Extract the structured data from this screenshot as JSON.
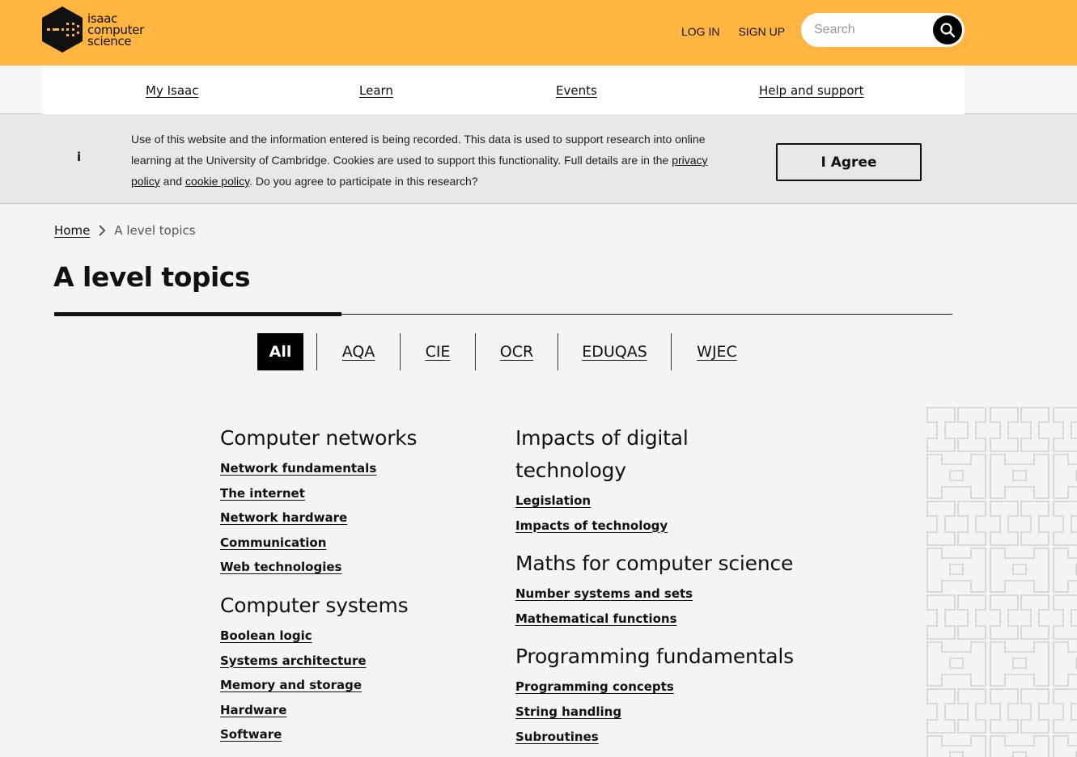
{
  "brand": {
    "logo_lines": [
      "isaac",
      "computer",
      "science"
    ],
    "accent_color": "#ffb53f"
  },
  "header": {
    "login_label": "LOG IN",
    "signup_label": "SIGN UP",
    "search_placeholder": "Search"
  },
  "nav": {
    "items": [
      {
        "label": "My Isaac"
      },
      {
        "label": "Learn"
      },
      {
        "label": "Events"
      },
      {
        "label": "Help and support"
      }
    ]
  },
  "cookie_banner": {
    "icon_text": "i",
    "text_part1": "Use of this website and the information entered is being recorded. This data is used to support research into online learning at the University of Cambridge. Cookies are used to support this functionality. Full details are in the ",
    "privacy_link": "privacy policy",
    "text_and": " and ",
    "cookie_link": "cookie policy",
    "text_part2": ". Do you agree to participate in this research?",
    "agree_label": "I Agree"
  },
  "breadcrumb": {
    "home": "Home",
    "current": "A level topics"
  },
  "page": {
    "title": "A level topics"
  },
  "filters": {
    "tabs": [
      {
        "label": "All",
        "active": true
      },
      {
        "label": "AQA",
        "active": false
      },
      {
        "label": "CIE",
        "active": false
      },
      {
        "label": "OCR",
        "active": false
      },
      {
        "label": "EDUQAS",
        "active": false
      },
      {
        "label": "WJEC",
        "active": false
      }
    ]
  },
  "topics": {
    "col1": [
      {
        "title": "Computer networks",
        "items": [
          "Network fundamentals",
          "The internet",
          "Network hardware",
          "Communication",
          "Web technologies"
        ]
      },
      {
        "title": "Computer systems",
        "items": [
          "Boolean logic",
          "Systems architecture",
          "Memory and storage",
          "Hardware",
          "Software"
        ]
      }
    ],
    "col2": [
      {
        "title": "Impacts of digital technology",
        "items": [
          "Legislation",
          "Impacts of technology"
        ]
      },
      {
        "title": "Maths for computer science",
        "items": [
          "Number systems and sets",
          "Mathematical functions"
        ]
      },
      {
        "title": "Programming fundamentals",
        "items": [
          "Programming concepts",
          "String handling",
          "Subroutines"
        ]
      }
    ]
  }
}
